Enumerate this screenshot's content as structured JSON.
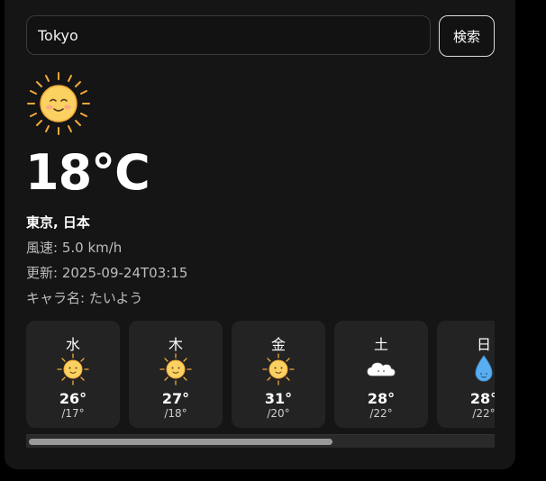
{
  "search": {
    "value": "Tokyo",
    "button_label": "検索"
  },
  "current": {
    "icon": "sun-character-icon",
    "temperature": "18°C",
    "location": "東京, 日本",
    "wind": "風速: 5.0 km/h",
    "updated": "更新: 2025-09-24T03:15",
    "character": "キャラ名: たいよう"
  },
  "forecast": [
    {
      "day": "水",
      "icon": "sun-icon",
      "max": "26°",
      "min": "/17°"
    },
    {
      "day": "木",
      "icon": "sun-icon",
      "max": "27°",
      "min": "/18°"
    },
    {
      "day": "金",
      "icon": "sun-icon",
      "max": "31°",
      "min": "/20°"
    },
    {
      "day": "土",
      "icon": "cloud-icon",
      "max": "28°",
      "min": "/22°"
    },
    {
      "day": "日",
      "icon": "raindrop-icon",
      "max": "28°",
      "min": "/22°"
    }
  ],
  "colors": {
    "sun": "#f9c74f",
    "sun_ray": "#f2a93b",
    "drop": "#5aaef0"
  }
}
